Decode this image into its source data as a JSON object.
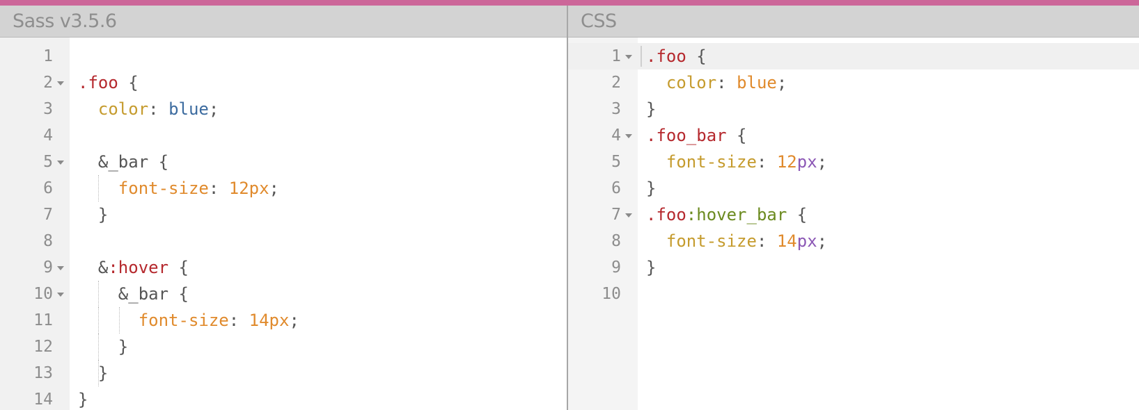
{
  "header": {
    "left_title": "Sass v3.5.6",
    "right_title": "CSS"
  },
  "colors": {
    "top_bar": "#cc6699",
    "selector": "#b5282d",
    "property": "#c59b2d",
    "keyword": "#3c6b9f",
    "number": "#e08a2c",
    "unit": "#8b57b5",
    "pseudo_css": "#6b8a1f"
  },
  "sass": {
    "lines": [
      {
        "n": "1",
        "fold": false,
        "tokens": []
      },
      {
        "n": "2",
        "fold": true,
        "tokens": [
          {
            "t": ".foo",
            "c": "sel"
          },
          {
            "t": " {",
            "c": "punc"
          }
        ]
      },
      {
        "n": "3",
        "fold": false,
        "tokens": [
          {
            "t": "  ",
            "c": "punc"
          },
          {
            "t": "color",
            "c": "prop"
          },
          {
            "t": ": ",
            "c": "punc"
          },
          {
            "t": "blue",
            "c": "kw"
          },
          {
            "t": ";",
            "c": "punc"
          }
        ]
      },
      {
        "n": "4",
        "fold": false,
        "tokens": []
      },
      {
        "n": "5",
        "fold": true,
        "tokens": [
          {
            "t": "  ",
            "c": "punc"
          },
          {
            "t": "&_bar",
            "c": "amp"
          },
          {
            "t": " {",
            "c": "punc"
          }
        ]
      },
      {
        "n": "6",
        "fold": false,
        "guides": [
          1
        ],
        "tokens": [
          {
            "t": "    ",
            "c": "punc"
          },
          {
            "t": "font-size",
            "c": "num"
          },
          {
            "t": ": ",
            "c": "punc"
          },
          {
            "t": "12px",
            "c": "num"
          },
          {
            "t": ";",
            "c": "punc"
          }
        ]
      },
      {
        "n": "7",
        "fold": false,
        "tokens": [
          {
            "t": "  ",
            "c": "punc"
          },
          {
            "t": "}",
            "c": "punc"
          }
        ]
      },
      {
        "n": "8",
        "fold": false,
        "tokens": []
      },
      {
        "n": "9",
        "fold": true,
        "tokens": [
          {
            "t": "  ",
            "c": "punc"
          },
          {
            "t": "&",
            "c": "amp"
          },
          {
            "t": ":hover",
            "c": "hover"
          },
          {
            "t": " {",
            "c": "punc"
          }
        ]
      },
      {
        "n": "10",
        "fold": true,
        "guides": [
          1
        ],
        "tokens": [
          {
            "t": "    ",
            "c": "punc"
          },
          {
            "t": "&_bar",
            "c": "amp"
          },
          {
            "t": " {",
            "c": "punc"
          }
        ]
      },
      {
        "n": "11",
        "fold": false,
        "guides": [
          1,
          2
        ],
        "tokens": [
          {
            "t": "      ",
            "c": "punc"
          },
          {
            "t": "font-size",
            "c": "num"
          },
          {
            "t": ": ",
            "c": "punc"
          },
          {
            "t": "14px",
            "c": "num"
          },
          {
            "t": ";",
            "c": "punc"
          }
        ]
      },
      {
        "n": "12",
        "fold": false,
        "guides": [
          1
        ],
        "tokens": [
          {
            "t": "    ",
            "c": "punc"
          },
          {
            "t": "}",
            "c": "punc"
          }
        ]
      },
      {
        "n": "13",
        "fold": false,
        "guides": [
          1
        ],
        "tokens": [
          {
            "t": "  ",
            "c": "punc"
          },
          {
            "t": "}",
            "c": "punc"
          }
        ]
      },
      {
        "n": "14",
        "fold": false,
        "tokens": [
          {
            "t": "}",
            "c": "punc"
          }
        ]
      }
    ]
  },
  "css": {
    "lines": [
      {
        "n": "1",
        "fold": true,
        "active": true,
        "tokens": [
          {
            "t": ".foo",
            "c": "sel"
          },
          {
            "t": " {",
            "c": "punc"
          }
        ]
      },
      {
        "n": "2",
        "fold": false,
        "tokens": [
          {
            "t": "  ",
            "c": "punc"
          },
          {
            "t": "color",
            "c": "prop"
          },
          {
            "t": ": ",
            "c": "punc"
          },
          {
            "t": "blue",
            "c": "kwcss"
          },
          {
            "t": ";",
            "c": "punc"
          }
        ]
      },
      {
        "n": "3",
        "fold": false,
        "tokens": [
          {
            "t": "}",
            "c": "punc"
          }
        ]
      },
      {
        "n": "4",
        "fold": true,
        "tokens": [
          {
            "t": ".foo_bar",
            "c": "sel"
          },
          {
            "t": " {",
            "c": "punc"
          }
        ]
      },
      {
        "n": "5",
        "fold": false,
        "tokens": [
          {
            "t": "  ",
            "c": "punc"
          },
          {
            "t": "font-size",
            "c": "prop"
          },
          {
            "t": ": ",
            "c": "punc"
          },
          {
            "t": "12",
            "c": "numcss"
          },
          {
            "t": "px",
            "c": "unit"
          },
          {
            "t": ";",
            "c": "punc"
          }
        ]
      },
      {
        "n": "6",
        "fold": false,
        "tokens": [
          {
            "t": "}",
            "c": "punc"
          }
        ]
      },
      {
        "n": "7",
        "fold": true,
        "tokens": [
          {
            "t": ".foo",
            "c": "sel"
          },
          {
            "t": ":hover_bar",
            "c": "pseudo"
          },
          {
            "t": " {",
            "c": "punc"
          }
        ]
      },
      {
        "n": "8",
        "fold": false,
        "tokens": [
          {
            "t": "  ",
            "c": "punc"
          },
          {
            "t": "font-size",
            "c": "prop"
          },
          {
            "t": ": ",
            "c": "punc"
          },
          {
            "t": "14",
            "c": "numcss"
          },
          {
            "t": "px",
            "c": "unit"
          },
          {
            "t": ";",
            "c": "punc"
          }
        ]
      },
      {
        "n": "9",
        "fold": false,
        "tokens": [
          {
            "t": "}",
            "c": "punc"
          }
        ]
      },
      {
        "n": "10",
        "fold": false,
        "tokens": []
      }
    ]
  }
}
